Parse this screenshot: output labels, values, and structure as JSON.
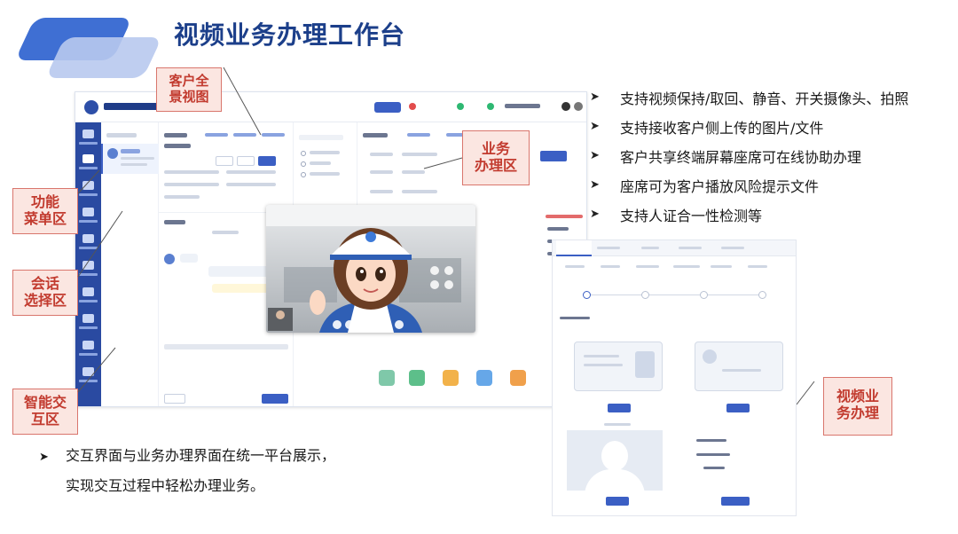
{
  "title": "视频业务办理工作台",
  "callouts": {
    "overview": [
      "客户全",
      "景视图"
    ],
    "biz_area": [
      "业务",
      "办理区"
    ],
    "menu": [
      "功能",
      "菜单区"
    ],
    "session": [
      "会话",
      "选择区"
    ],
    "interaction": [
      "智能交",
      "互区"
    ],
    "video_biz": [
      "视频业",
      "务办理"
    ]
  },
  "bullets": [
    "支持视频保持/取回、静音、开关摄像头、拍照",
    "支持接收客户侧上传的图片/文件",
    "客户共享终端屏幕座席可在线协助办理",
    "座席可为客户播放风险提示文件",
    "支持人证合一性检测等"
  ],
  "bottom_note": {
    "line1": "交互界面与业务办理界面在统一平台展示，",
    "line2": "实现交互过程中轻松办理业务。"
  },
  "colors": {
    "title": "#1c3f8a",
    "callout_text": "#c23b2f",
    "callout_bg": "#fbe6e1",
    "app_sidebar": "#2a4aa1"
  },
  "icons": {
    "bullet": "arrow-right-icon",
    "app_logo": "app-logo-icon"
  }
}
